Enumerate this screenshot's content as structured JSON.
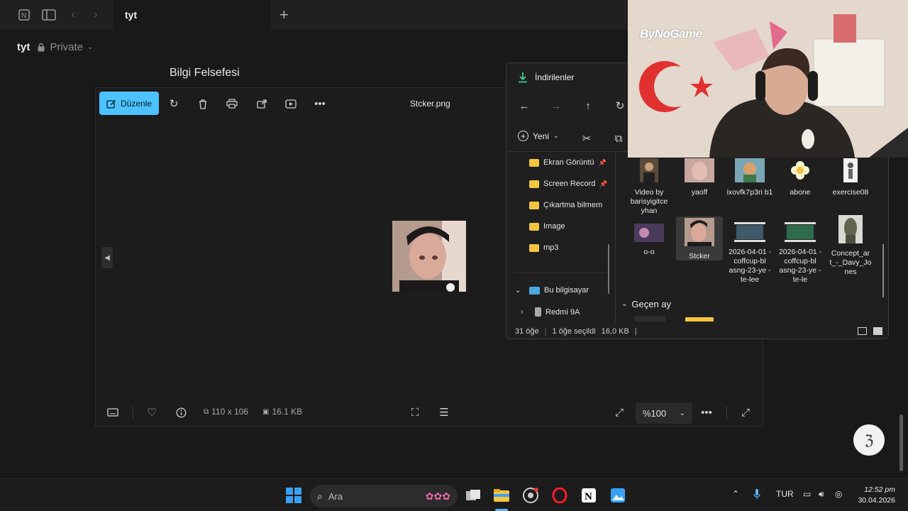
{
  "notion": {
    "tab_title": "tyt",
    "workspace": "tyt",
    "privacy": "Private",
    "page_heading": "Bilgi Felsefesi"
  },
  "viewer": {
    "edit_label": "Düzenle",
    "filename": "Stcker.png",
    "dimensions": "110 x 106",
    "filesize": "16.1 KB",
    "zoom": "%100"
  },
  "explorer": {
    "title": "İndirilenler",
    "new_label": "Yeni",
    "sidebar": [
      {
        "label": "Ekran Görüntü",
        "pinned": true
      },
      {
        "label": "Screen Record",
        "pinned": true
      },
      {
        "label": "Çıkartma bilmem",
        "pinned": false
      },
      {
        "label": "Image",
        "pinned": false
      },
      {
        "label": "mp3",
        "pinned": false
      }
    ],
    "this_pc": "Bu bilgisayar",
    "device": "Redmi 9A",
    "files": [
      {
        "name": "Video by barisyigitce yhan",
        "icon": "video-thumb-icon"
      },
      {
        "name": "yaoff",
        "icon": "image-thumb-icon"
      },
      {
        "name": "ixovfk7p3ri b1",
        "icon": "image-thumb-icon"
      },
      {
        "name": "abone",
        "icon": "image-thumb-icon"
      },
      {
        "name": "exercise08",
        "icon": "image-thumb-icon"
      },
      {
        "name": "o-o",
        "icon": "image-thumb-icon"
      },
      {
        "name": "Stcker",
        "icon": "image-thumb-icon"
      },
      {
        "name": "2026-04-01 -coffcup-bl asng-23-ye -te-lee",
        "icon": "video-thumb-icon"
      },
      {
        "name": "2026-04-01 -coffcup-bl asng-23-ye -te-le",
        "icon": "video-thumb-icon"
      },
      {
        "name": "Concept_ar t_-_Davy_Jo nes",
        "icon": "image-thumb-icon"
      }
    ],
    "group_label": "Geçen ay",
    "status_count": "31 öğe",
    "status_selected": "1 öğe seçildi",
    "status_size": "16,0 KB"
  },
  "webcam": {
    "logo_text": "ByNoGame"
  },
  "taskbar": {
    "search_placeholder": "Ara",
    "language": "TUR",
    "time": "12:52 pm",
    "date": "30.04.2026"
  }
}
